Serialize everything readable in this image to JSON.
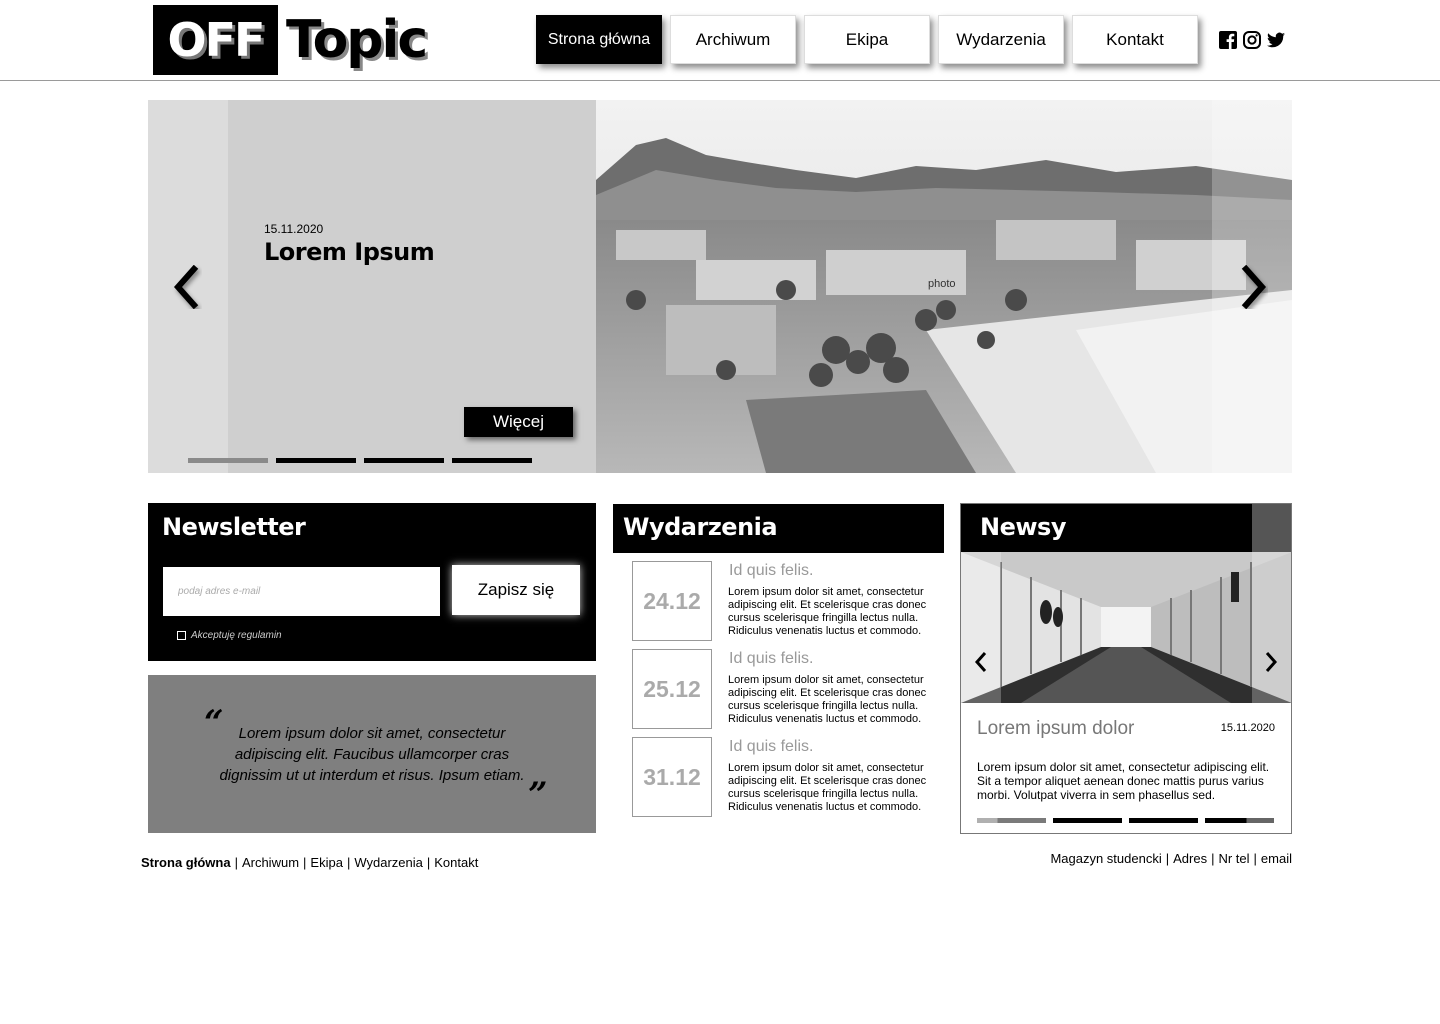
{
  "header": {
    "logo": {
      "part1": "OFF",
      "part2": "Topic"
    },
    "nav": [
      {
        "label": "Strona główna",
        "active": true
      },
      {
        "label": "Archiwum",
        "active": false
      },
      {
        "label": "Ekipa",
        "active": false
      },
      {
        "label": "Wydarzenia",
        "active": false
      },
      {
        "label": "Kontakt",
        "active": false
      }
    ],
    "socials": [
      "facebook-icon",
      "instagram-icon",
      "twitter-icon"
    ]
  },
  "hero": {
    "date": "15.11.2020",
    "title": "Lorem Ipsum",
    "more_label": "Więcej",
    "photo_label": "photo",
    "slides_count": 4,
    "active_slide": 0
  },
  "newsletter": {
    "title": "Newsletter",
    "email_placeholder": "podaj adres e-mail",
    "submit_label": "Zapisz się",
    "terms_label": "Akceptuję regulamin",
    "terms_checked": false
  },
  "quote": {
    "open_mark": "“",
    "close_mark": "”",
    "text": "Lorem ipsum dolor sit amet, consectetur adipiscing elit. Faucibus ullamcorper cras dignissim ut ut interdum et risus. Ipsum etiam."
  },
  "events": {
    "title": "Wydarzenia",
    "items": [
      {
        "date": "24.12",
        "title": "Id quis felis.",
        "desc": "Lorem ipsum dolor sit amet, consectetur adipiscing elit. Et scelerisque cras donec cursus scelerisque fringilla lectus nulla. Ridiculus venenatis luctus et commodo."
      },
      {
        "date": "25.12",
        "title": "Id quis felis.",
        "desc": "Lorem ipsum dolor sit amet, consectetur adipiscing elit. Et scelerisque cras donec cursus scelerisque fringilla lectus nulla. Ridiculus venenatis luctus et commodo."
      },
      {
        "date": "31.12",
        "title": "Id quis felis.",
        "desc": "Lorem ipsum dolor sit amet, consectetur adipiscing elit. Et scelerisque cras donec cursus scelerisque fringilla lectus nulla. Ridiculus venenatis luctus et commodo."
      }
    ]
  },
  "news": {
    "title": "Newsy",
    "item_title": "Lorem ipsum dolor",
    "item_date": "15.11.2020",
    "item_text": "Lorem ipsum dolor sit amet, consectetur adipiscing elit. Sit a tempor aliquet aenean donec mattis purus varius morbi. Volutpat viverra in sem phasellus sed.",
    "slides_count": 4,
    "active_slide": 0
  },
  "footer": {
    "left": [
      "Strona główna",
      "Archiwum",
      "Ekipa",
      "Wydarzenia",
      "Kontakt"
    ],
    "right": [
      "Magazyn studencki",
      "Adres",
      "Nr tel",
      "email"
    ]
  },
  "colors": {
    "primary": "#000000",
    "panel": "#cfcfcf",
    "quote_bg": "#7f7f7f",
    "muted_text": "#999999"
  }
}
